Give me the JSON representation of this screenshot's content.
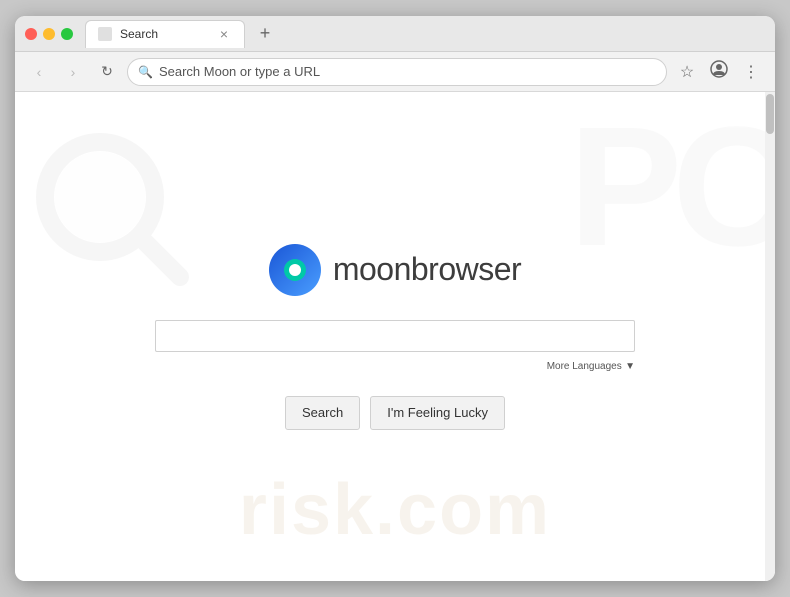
{
  "browser": {
    "tab": {
      "title": "Search",
      "close_label": "×"
    },
    "new_tab_label": "+",
    "nav": {
      "back_label": "‹",
      "forward_label": "›",
      "refresh_label": "↻",
      "address_placeholder": "Search Moon or type a URL",
      "address_value": "Search Moon or type a URL",
      "bookmark_label": "☆",
      "profile_label": "○",
      "menu_label": "⋮"
    }
  },
  "page": {
    "logo_text": "moonbrowser",
    "search_placeholder": "",
    "more_languages_label": "More Languages",
    "more_languages_arrow": "▼",
    "search_button_label": "Search",
    "lucky_button_label": "I'm Feeling Lucky"
  },
  "watermark": {
    "bottom_text": "risk.com"
  },
  "colors": {
    "logo_blue_dark": "#1a56d6",
    "logo_blue_light": "#4a9eff",
    "logo_teal": "#00c9a7",
    "accent": "#3d6fd6"
  }
}
